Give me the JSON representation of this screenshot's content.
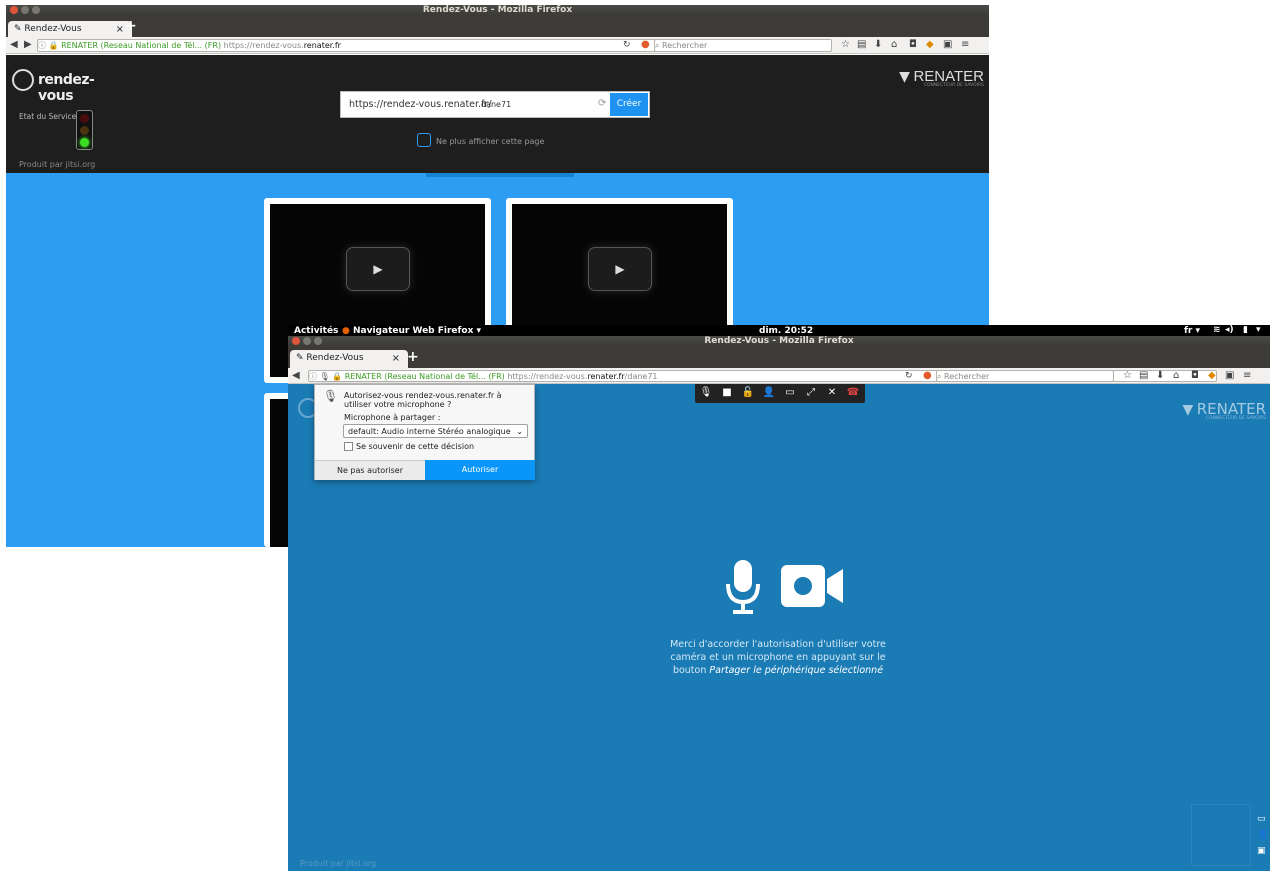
{
  "back_window": {
    "title": "Rendez-Vous - Mozilla Firefox",
    "tab_label": "Rendez-Vous",
    "tab_close": "×",
    "new_tab": "+",
    "url_identity": "RENATER (Reseau National de Tél... (FR)",
    "url_plain": "https://rendez-vous.",
    "url_domain": "renater.fr",
    "search_placeholder": "Rechercher",
    "logo_text": "rendez-vous",
    "brand_text": "RENATER",
    "brand_sub": "CONNECTEUR DE SAVOIRS",
    "service_state_label": "Etat du Service:",
    "powered_by": "Produit par jitsi.org",
    "room_prefix": "https://rendez-vous.renater.fr/",
    "room_name": "dane71",
    "create_button": "Créer",
    "hide_page_label": "Ne plus afficher cette page",
    "traffic_light_state": "green"
  },
  "gnome_bar": {
    "activities": "Activités",
    "app_menu": "Navigateur Web Firefox ▾",
    "clock": "dim. 20:52",
    "lang": "fr ▾"
  },
  "front_window": {
    "title": "Rendez-Vous - Mozilla Firefox",
    "tab_label": "Rendez-Vous",
    "tab_close": "×",
    "new_tab": "+",
    "url_identity": "RENATER (Reseau National de Tél... (FR)",
    "url_plain": "https://rendez-vous.",
    "url_domain": "renater.fr",
    "url_path": "/dane71",
    "search_placeholder": "Rechercher",
    "brand_text": "RENATER",
    "brand_sub": "CONNECTEUR DE SAVOIRS",
    "powered_by": "Produit par jitsi.org",
    "permission_text_normal": "Merci d'accorder l'autorisation d'utiliser votre caméra et un microphone en appuyant sur le bouton",
    "permission_text_emph": "Partager le périphérique sélectionné"
  },
  "permission_popup": {
    "question": "Autorisez-vous rendez-vous.renater.fr à utiliser votre microphone ?",
    "mic_label": "Microphone à partager :",
    "mic_selected": "default: Audio interne Stéréo analogique",
    "remember_label": "Se souvenir de cette décision",
    "remember_checked": false,
    "deny_button": "Ne pas autoriser",
    "allow_button": "Autoriser"
  },
  "colors": {
    "back_blue": "#2d9cf3",
    "front_blue": "#1a7bb5",
    "allow_blue": "#0996f8",
    "hangup_red": "#e04242"
  }
}
